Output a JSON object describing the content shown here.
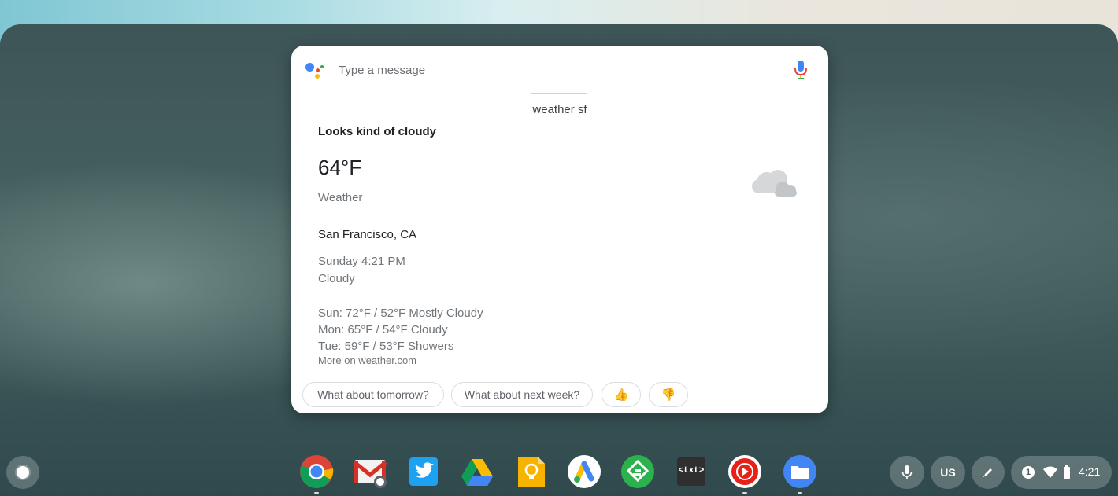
{
  "assistant": {
    "input_placeholder": "Type a message",
    "query": "weather sf",
    "summary": "Looks kind of cloudy",
    "temperature": "64°F",
    "temperature_label": "Weather",
    "location": "San Francisco, CA",
    "datetime": "Sunday 4:21 PM",
    "condition": "Cloudy",
    "forecast": [
      "Sun: 72°F / 52°F Mostly Cloudy",
      "Mon: 65°F / 54°F Cloudy",
      "Tue: 59°F / 53°F Showers"
    ],
    "more_link": "More on weather.com",
    "suggestions": [
      "What about tomorrow?",
      "What about next week?"
    ],
    "feedback": [
      "👍",
      "👎"
    ],
    "icons": [
      "google-assistant-icon",
      "microphone-icon",
      "cloudy-icon"
    ]
  },
  "shelf": {
    "apps": [
      "chrome",
      "gmail",
      "twitter",
      "google-drive",
      "google-keep",
      "google-ads",
      "feedly",
      "text",
      "youtube-music",
      "files"
    ],
    "text_app_label": "<txt>",
    "keyboard_layout": "US",
    "notification_count": "1",
    "time": "4:21"
  },
  "colors": {
    "google_blue": "#4285f4",
    "google_red": "#ea4335",
    "google_yellow": "#fbbc05",
    "google_green": "#34a853"
  }
}
